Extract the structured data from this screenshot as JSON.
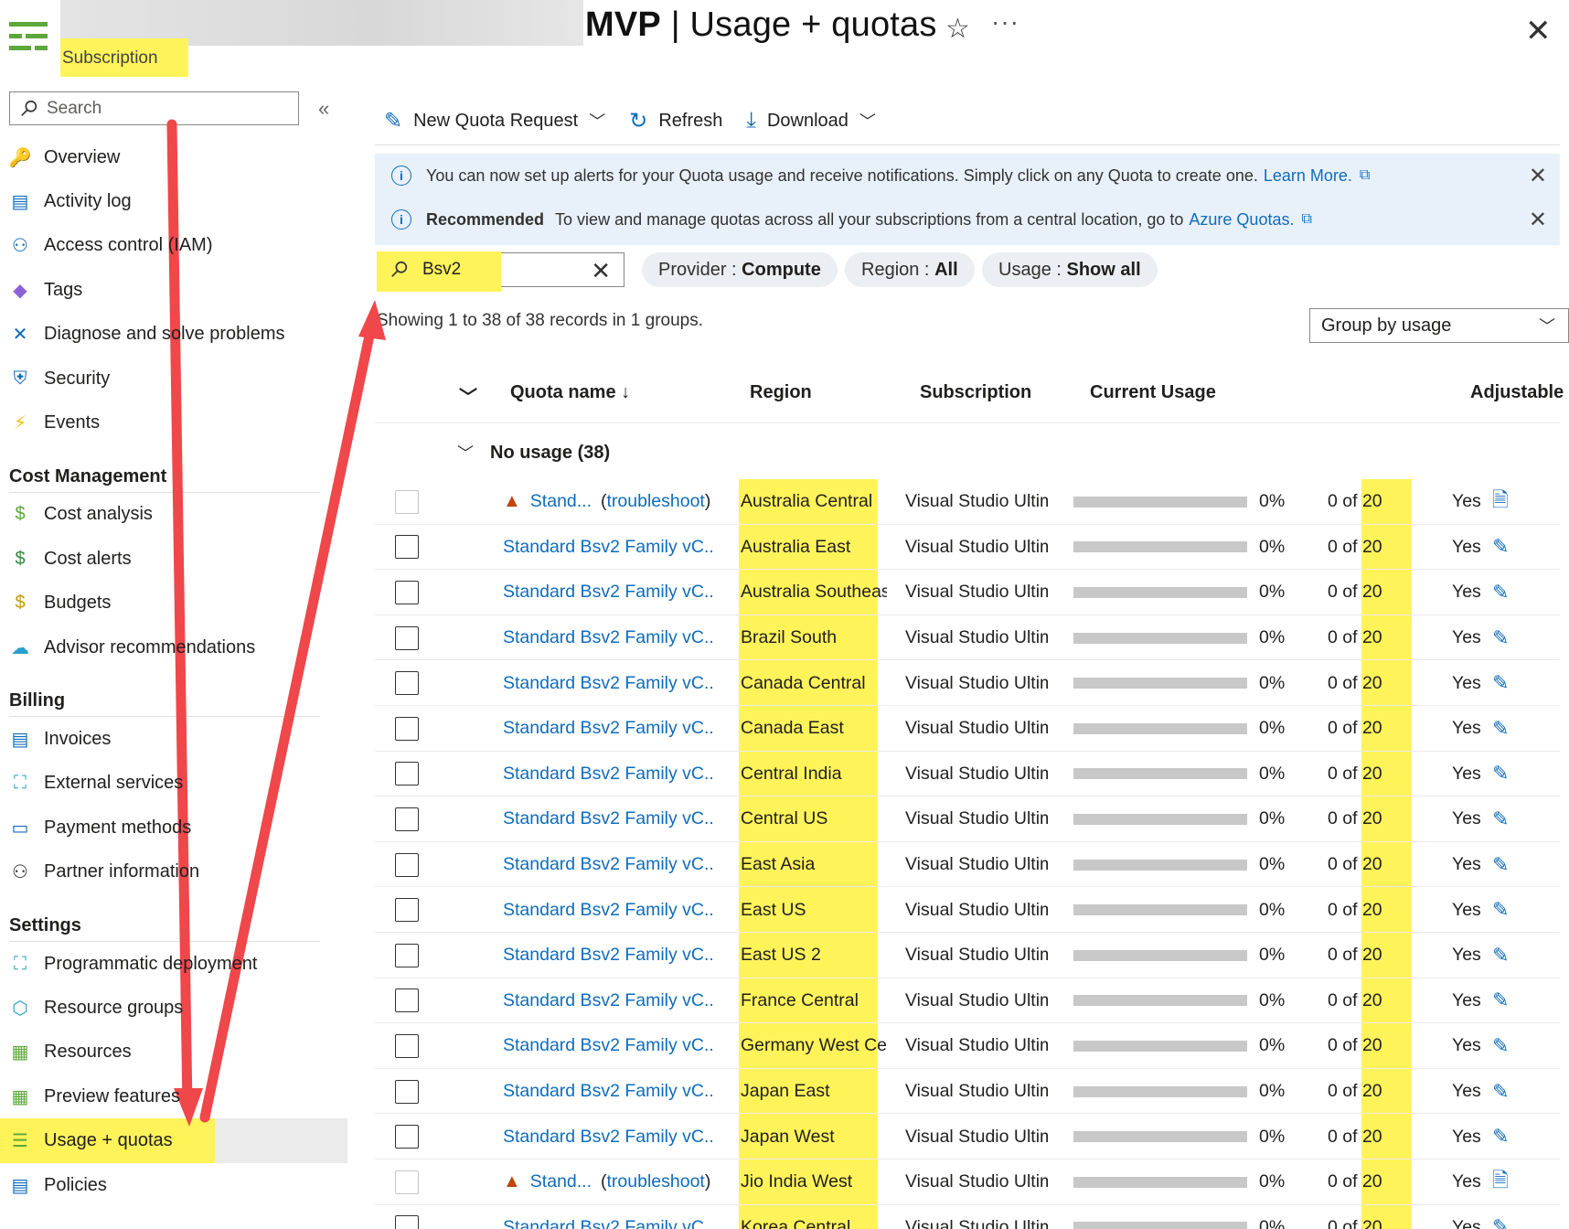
{
  "header": {
    "subscription_label": "Subscription",
    "title_bold": "MVP",
    "title_rest": " | Usage + quotas",
    "star_glyph": "☆",
    "more_glyph": "···",
    "close_glyph": "✕"
  },
  "sidebar": {
    "search_placeholder": "Search",
    "collapse_glyph": "«",
    "groups": [
      {
        "section": "",
        "items": [
          {
            "label": "Overview",
            "icon": "key-icon"
          },
          {
            "label": "Activity log",
            "icon": "activity-log-icon"
          },
          {
            "label": "Access control (IAM)",
            "icon": "people-icon"
          },
          {
            "label": "Tags",
            "icon": "tag-icon"
          },
          {
            "label": "Diagnose and solve problems",
            "icon": "wrench-icon"
          },
          {
            "label": "Security",
            "icon": "shield-icon"
          },
          {
            "label": "Events",
            "icon": "bolt-icon"
          }
        ]
      },
      {
        "section": "Cost Management",
        "items": [
          {
            "label": "Cost analysis",
            "icon": "cost-analysis-icon"
          },
          {
            "label": "Cost alerts",
            "icon": "cost-alert-icon"
          },
          {
            "label": "Budgets",
            "icon": "budget-icon"
          },
          {
            "label": "Advisor recommendations",
            "icon": "advisor-icon"
          }
        ]
      },
      {
        "section": "Billing",
        "items": [
          {
            "label": "Invoices",
            "icon": "invoice-icon"
          },
          {
            "label": "External services",
            "icon": "external-services-icon"
          },
          {
            "label": "Payment methods",
            "icon": "card-icon"
          },
          {
            "label": "Partner information",
            "icon": "partner-icon"
          }
        ]
      },
      {
        "section": "Settings",
        "items": [
          {
            "label": "Programmatic deployment",
            "icon": "deployment-icon"
          },
          {
            "label": "Resource groups",
            "icon": "resource-group-icon"
          },
          {
            "label": "Resources",
            "icon": "grid-icon"
          },
          {
            "label": "Preview features",
            "icon": "preview-icon"
          },
          {
            "label": "Usage + quotas",
            "icon": "quota-icon",
            "active": true
          },
          {
            "label": "Policies",
            "icon": "policy-icon"
          }
        ]
      }
    ]
  },
  "toolbar": {
    "new_quota": "New Quota Request",
    "refresh": "Refresh",
    "download": "Download"
  },
  "banners": {
    "alert_text": "You can now set up alerts for your Quota usage and receive notifications. Simply click on any Quota to create one.",
    "alert_link": "Learn More.",
    "rec_bold": "Recommended",
    "rec_text": "To view and manage quotas across all your subscriptions from a central location, go to",
    "rec_link": "Azure Quotas."
  },
  "filters": {
    "search_value": "Bsv2",
    "provider_key": "Provider : ",
    "provider_val": "Compute",
    "region_key": "Region : ",
    "region_val": "All",
    "usage_key": "Usage : ",
    "usage_val": "Show all"
  },
  "records_text": "Showing 1 to 38 of 38 records in 1 groups.",
  "group_by": "Group by usage",
  "table": {
    "headers": {
      "quota_name": "Quota name ↓",
      "region": "Region",
      "subscription": "Subscription",
      "current_usage": "Current Usage",
      "adjustable": "Adjustable"
    },
    "group_label": "No usage (38)",
    "rows": [
      {
        "name": "Stand...",
        "troubleshoot": true,
        "region": "Australia Central",
        "subscription": "Visual Studio Ultimate",
        "pct": "0%",
        "usage": "0 of ",
        "limit": "20",
        "adjustable": "Yes"
      },
      {
        "name": "Standard Bsv2 Family vC...",
        "troubleshoot": false,
        "region": "Australia East",
        "subscription": "Visual Studio Ultimate",
        "pct": "0%",
        "usage": "0 of ",
        "limit": "20",
        "adjustable": "Yes"
      },
      {
        "name": "Standard Bsv2 Family vC...",
        "troubleshoot": false,
        "region": "Australia Southeast",
        "subscription": "Visual Studio Ultimate",
        "pct": "0%",
        "usage": "0 of ",
        "limit": "20",
        "adjustable": "Yes"
      },
      {
        "name": "Standard Bsv2 Family vC...",
        "troubleshoot": false,
        "region": "Brazil South",
        "subscription": "Visual Studio Ultimate",
        "pct": "0%",
        "usage": "0 of ",
        "limit": "20",
        "adjustable": "Yes"
      },
      {
        "name": "Standard Bsv2 Family vC...",
        "troubleshoot": false,
        "region": "Canada Central",
        "subscription": "Visual Studio Ultimate",
        "pct": "0%",
        "usage": "0 of ",
        "limit": "20",
        "adjustable": "Yes"
      },
      {
        "name": "Standard Bsv2 Family vC...",
        "troubleshoot": false,
        "region": "Canada East",
        "subscription": "Visual Studio Ultimate",
        "pct": "0%",
        "usage": "0 of ",
        "limit": "20",
        "adjustable": "Yes"
      },
      {
        "name": "Standard Bsv2 Family vC...",
        "troubleshoot": false,
        "region": "Central India",
        "subscription": "Visual Studio Ultimate",
        "pct": "0%",
        "usage": "0 of ",
        "limit": "20",
        "adjustable": "Yes"
      },
      {
        "name": "Standard Bsv2 Family vC...",
        "troubleshoot": false,
        "region": "Central US",
        "subscription": "Visual Studio Ultimate",
        "pct": "0%",
        "usage": "0 of ",
        "limit": "20",
        "adjustable": "Yes"
      },
      {
        "name": "Standard Bsv2 Family vC...",
        "troubleshoot": false,
        "region": "East Asia",
        "subscription": "Visual Studio Ultimate",
        "pct": "0%",
        "usage": "0 of ",
        "limit": "20",
        "adjustable": "Yes"
      },
      {
        "name": "Standard Bsv2 Family vC...",
        "troubleshoot": false,
        "region": "East US",
        "subscription": "Visual Studio Ultimate",
        "pct": "0%",
        "usage": "0 of ",
        "limit": "20",
        "adjustable": "Yes"
      },
      {
        "name": "Standard Bsv2 Family vC...",
        "troubleshoot": false,
        "region": "East US 2",
        "subscription": "Visual Studio Ultimate",
        "pct": "0%",
        "usage": "0 of ",
        "limit": "20",
        "adjustable": "Yes"
      },
      {
        "name": "Standard Bsv2 Family vC...",
        "troubleshoot": false,
        "region": "France Central",
        "subscription": "Visual Studio Ultimate",
        "pct": "0%",
        "usage": "0 of ",
        "limit": "20",
        "adjustable": "Yes"
      },
      {
        "name": "Standard Bsv2 Family vC...",
        "troubleshoot": false,
        "region": "Germany West Central",
        "subscription": "Visual Studio Ultimate",
        "pct": "0%",
        "usage": "0 of ",
        "limit": "20",
        "adjustable": "Yes"
      },
      {
        "name": "Standard Bsv2 Family vC...",
        "troubleshoot": false,
        "region": "Japan East",
        "subscription": "Visual Studio Ultimate",
        "pct": "0%",
        "usage": "0 of ",
        "limit": "20",
        "adjustable": "Yes"
      },
      {
        "name": "Standard Bsv2 Family vC...",
        "troubleshoot": false,
        "region": "Japan West",
        "subscription": "Visual Studio Ultimate",
        "pct": "0%",
        "usage": "0 of ",
        "limit": "20",
        "adjustable": "Yes"
      },
      {
        "name": "Stand...",
        "troubleshoot": true,
        "region": "Jio India West",
        "subscription": "Visual Studio Ultimate",
        "pct": "0%",
        "usage": "0 of ",
        "limit": "20",
        "adjustable": "Yes"
      },
      {
        "name": "Standard Bsv2 Family vC...",
        "troubleshoot": false,
        "region": "Korea Central",
        "subscription": "Visual Studio Ultimate",
        "pct": "0%",
        "usage": "0 of ",
        "limit": "20",
        "adjustable": "Yes"
      }
    ],
    "troubleshoot_label": "troubleshoot",
    "usage_fraction": 0
  },
  "colors": {
    "highlight": "#fff35a",
    "link": "#0f6cbd",
    "arrow": "#f0474a",
    "banner_bg": "#e8f1fa"
  }
}
